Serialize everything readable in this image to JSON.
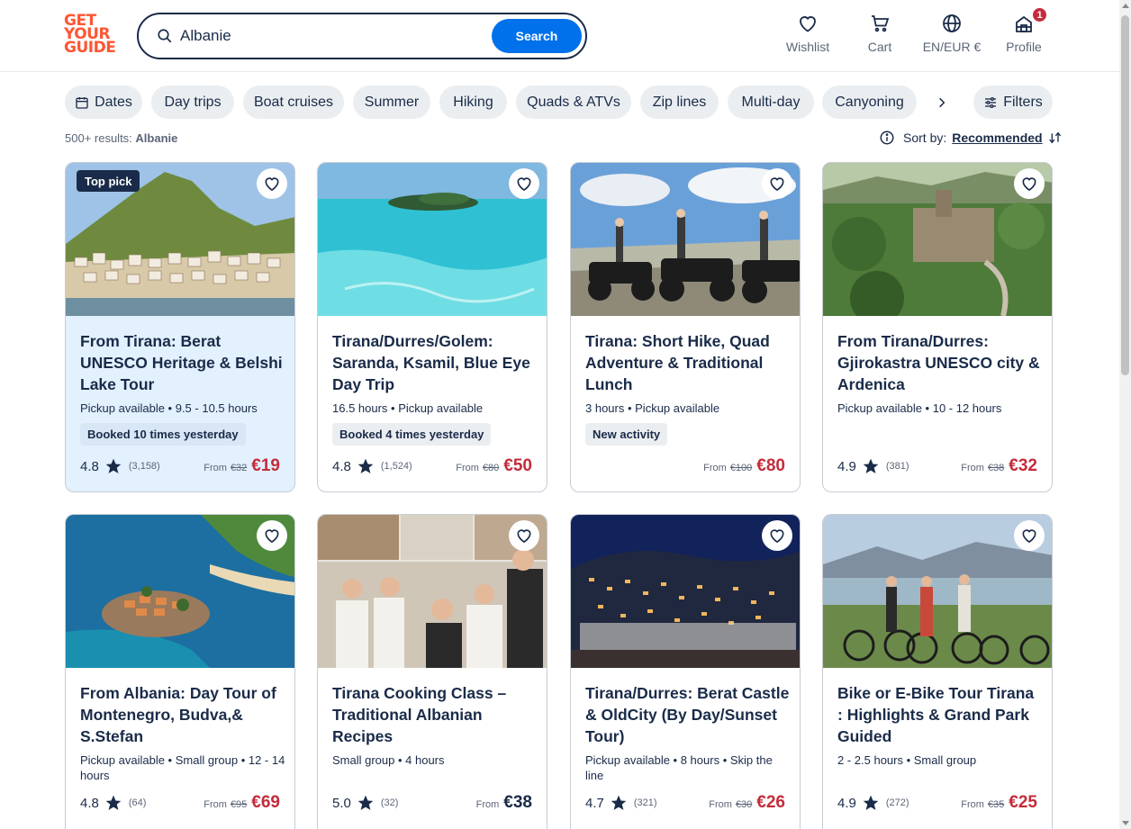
{
  "header": {
    "logo_lines": [
      "GET",
      "YOUR",
      "GUIDE"
    ],
    "search_value": "Albanie",
    "search_button": "Search",
    "nav": {
      "wishlist": "Wishlist",
      "cart": "Cart",
      "language": "EN/EUR €",
      "profile": "Profile",
      "profile_badge": "1"
    }
  },
  "chips": [
    "Dates",
    "Day trips",
    "Boat cruises",
    "Summer",
    "Hiking",
    "Quads & ATVs",
    "Zip lines",
    "Multi-day",
    "Canyoning"
  ],
  "filters_label": "Filters",
  "results": {
    "count_prefix": "500+ results:",
    "count_query": "Albanie",
    "sort_label": "Sort by:",
    "sort_value": "Recommended"
  },
  "cards": [
    {
      "title": "From Tirana: Berat UNESCO Heritage & Belshi Lake Tour",
      "meta": "Pickup available • 9.5 - 10.5 hours",
      "tag": "Booked 10 times yesterday",
      "badge": "Top pick",
      "rating": "4.8",
      "reviews": "(3,158)",
      "from": "From",
      "old_price": "€32",
      "price": "€19"
    },
    {
      "title": "Tirana/Durres/Golem: Saranda, Ksamil, Blue Eye Day Trip",
      "meta": "16.5 hours • Pickup available",
      "tag": "Booked 4 times yesterday",
      "rating": "4.8",
      "reviews": "(1,524)",
      "from": "From",
      "old_price": "€80",
      "price": "€50"
    },
    {
      "title": "Tirana: Short Hike, Quad Adventure & Traditional Lunch",
      "meta": "3 hours • Pickup available",
      "tag": "New activity",
      "rating": "",
      "reviews": "",
      "from": "From",
      "old_price": "€100",
      "price": "€80"
    },
    {
      "title": "From Tirana/Durres: Gjirokastra UNESCO city & Ardenica",
      "meta": "Pickup available • 10 - 12 hours",
      "tag": "",
      "rating": "4.9",
      "reviews": "(381)",
      "from": "From",
      "old_price": "€38",
      "price": "€32"
    },
    {
      "title": "From Albania: Day Tour of Montenegro, Budva,& S.Stefan",
      "meta": "Pickup available • Small group • 12 - 14 hours",
      "tag": "",
      "rating": "4.8",
      "reviews": "(64)",
      "from": "From",
      "old_price": "€95",
      "price": "€69"
    },
    {
      "title": "Tirana Cooking Class – Traditional Albanian Recipes",
      "meta": "Small group • 4 hours",
      "tag": "",
      "rating": "5.0",
      "reviews": "(32)",
      "from": "From",
      "old_price": "",
      "price": "€38"
    },
    {
      "title": "Tirana/Durres: Berat Castle & OldCity (By Day/Sunset Tour)",
      "meta": "Pickup available • 8 hours • Skip the line",
      "tag": "",
      "rating": "4.7",
      "reviews": "(321)",
      "from": "From",
      "old_price": "€30",
      "price": "€26"
    },
    {
      "title": "Bike or E-Bike Tour Tirana : Highlights & Grand Park Guided",
      "meta": "2 - 2.5 hours • Small group",
      "tag": "",
      "rating": "4.9",
      "reviews": "(272)",
      "from": "From",
      "old_price": "€35",
      "price": "€25"
    }
  ],
  "colors": {
    "brand": "#ff5533",
    "primary": "#0071eb",
    "text": "#1a2b49",
    "price": "#c32c3c",
    "chip_bg": "#ebeef1",
    "highlight_card": "#e3f0fd"
  },
  "icons": [
    "search-icon",
    "heart-icon",
    "cart-icon",
    "globe-icon",
    "profile-icon",
    "calendar-icon",
    "chevron-right-icon",
    "filters-icon",
    "info-icon",
    "sort-icon",
    "star-icon"
  ]
}
